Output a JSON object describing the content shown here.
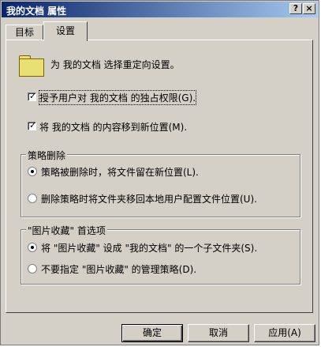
{
  "window": {
    "title": "我的文档 属性",
    "help_button": "?",
    "close_button": "×"
  },
  "tabs": [
    {
      "label": "目标",
      "active": false
    },
    {
      "label": "设置",
      "active": true
    }
  ],
  "header_text": "为 我的文档 选择重定向设置。",
  "checkboxes": [
    {
      "label": "授予用户对 我的文档 的独占权限(G).",
      "checked": true
    },
    {
      "label": "将 我的文档 的内容移到新位置(M).",
      "checked": true
    }
  ],
  "policy_removal": {
    "title": "策略删除",
    "options": [
      {
        "label": "策略被删除时，将文件留在新位置(L).",
        "selected": true
      },
      {
        "label": "删除策略时将文件夹移回本地用户配置文件位置(U).",
        "selected": false
      }
    ]
  },
  "pictures_pref": {
    "title": "\"图片收藏\" 首选项",
    "options": [
      {
        "label": "将 \"图片收藏\" 设成 \"我的文档\" 的一个子文件夹(S).",
        "selected": true
      },
      {
        "label": "不要指定 \"图片收藏\" 的管理策略(D).",
        "selected": false
      }
    ]
  },
  "buttons": {
    "ok": "确定",
    "cancel": "取消",
    "apply": "应用(A)"
  },
  "colors": {
    "title_start": "#0a246a",
    "title_end": "#a6caf0",
    "face": "#d4d0c8",
    "folder": "#e8e070"
  },
  "icons": {
    "folder": "folder-icon",
    "check": "check-icon",
    "radio_dot": "radio-dot-icon"
  }
}
